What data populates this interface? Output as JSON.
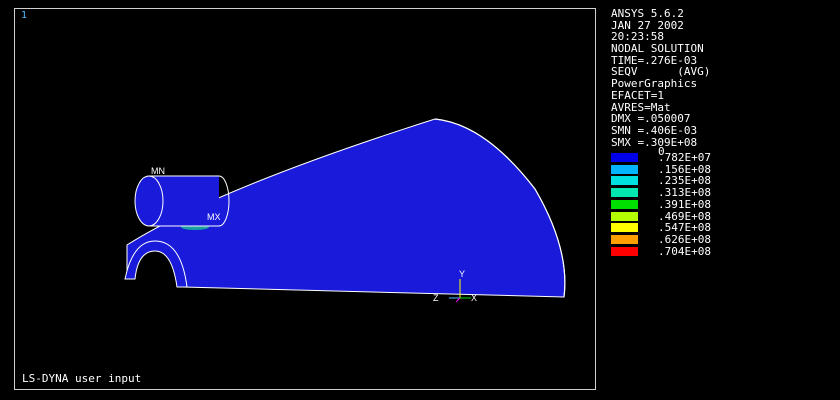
{
  "viewport": {
    "window_number": "1",
    "footer_text": "LS-DYNA user input",
    "markers": {
      "min": "MN",
      "max": "MX"
    },
    "triad": {
      "x": "X",
      "y": "Y",
      "z": "Z"
    }
  },
  "info": {
    "lines": [
      "ANSYS 5.6.2",
      "JAN 27 2002",
      "20:23:58",
      "NODAL SOLUTION",
      "TIME=.276E-03",
      "SEQV      (AVG)",
      "PowerGraphics",
      "EFACET=1",
      "AVRES=Mat",
      "DMX =.050007",
      "SMN =.406E-03",
      "SMX =.309E+08"
    ]
  },
  "legend": {
    "zero_label": "0",
    "entries": [
      {
        "label": ".782E+07",
        "color": "#0000e8"
      },
      {
        "label": ".156E+08",
        "color": "#00b4ff"
      },
      {
        "label": ".235E+08",
        "color": "#00e0e0"
      },
      {
        "label": ".313E+08",
        "color": "#00e8b0"
      },
      {
        "label": ".391E+08",
        "color": "#00e000"
      },
      {
        "label": ".469E+08",
        "color": "#b4ff00"
      },
      {
        "label": ".547E+08",
        "color": "#ffff00"
      },
      {
        "label": ".626E+08",
        "color": "#ffa000"
      },
      {
        "label": ".704E+08",
        "color": "#ff0000"
      }
    ]
  },
  "colors": {
    "model_fill": "#1a1adb",
    "model_edge": "#ffffff",
    "contact_patch": "#1aa0a0"
  }
}
